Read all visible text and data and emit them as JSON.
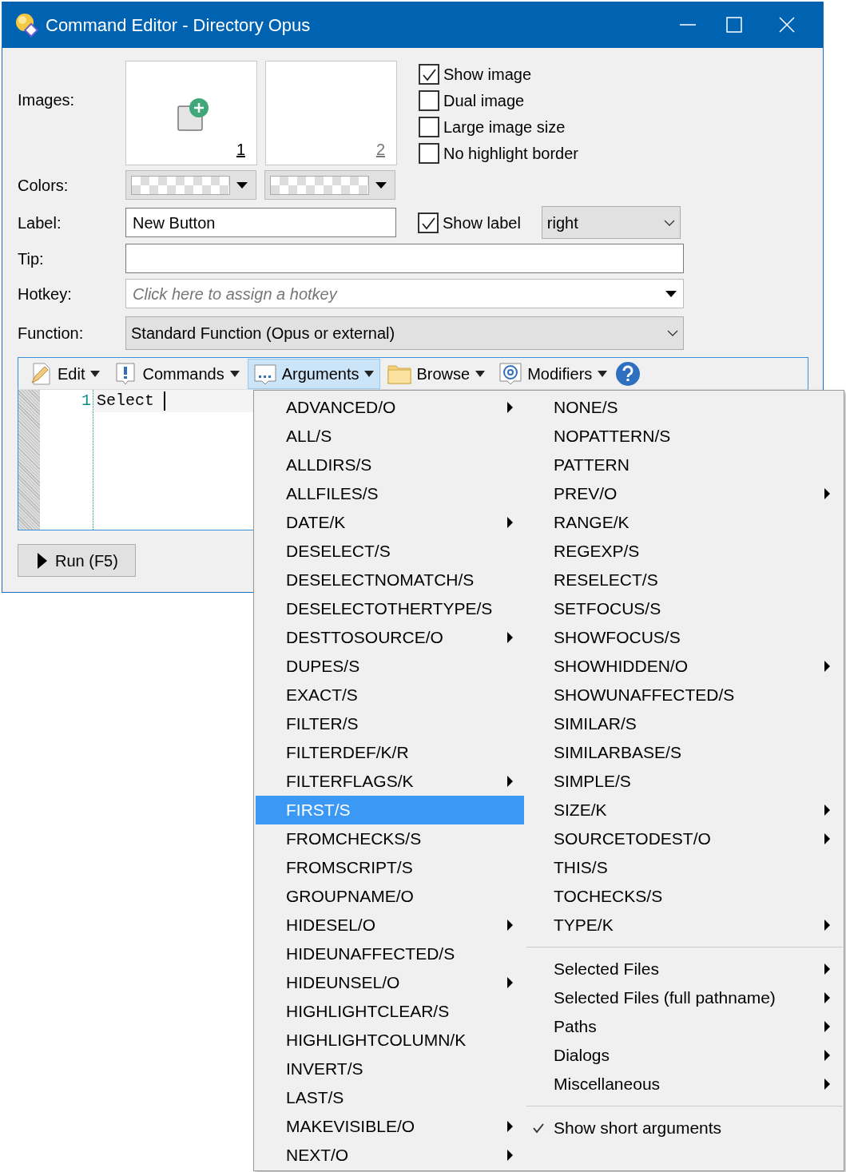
{
  "window": {
    "title": "Command Editor - Directory Opus"
  },
  "form": {
    "images_label": "Images:",
    "images": [
      {
        "number": "1",
        "disabled": false
      },
      {
        "number": "2",
        "disabled": true
      }
    ],
    "image_options": [
      {
        "label": "Show image",
        "checked": true
      },
      {
        "label": "Dual image",
        "checked": false
      },
      {
        "label": "Large image size",
        "checked": false
      },
      {
        "label": "No highlight border",
        "checked": false
      }
    ],
    "colors_label": "Colors:",
    "label_label": "Label:",
    "label_value": "New Button",
    "show_label": {
      "label": "Show label",
      "checked": true
    },
    "label_position": "right",
    "tip_label": "Tip:",
    "hotkey_label": "Hotkey:",
    "hotkey_placeholder": "Click here to assign a hotkey",
    "function_label": "Function:",
    "function_value": "Standard Function (Opus or external)"
  },
  "toolbar": [
    {
      "label": "Edit",
      "selected": false
    },
    {
      "label": "Commands",
      "selected": false
    },
    {
      "label": "Arguments",
      "selected": true
    },
    {
      "label": "Browse",
      "selected": false
    },
    {
      "label": "Modifiers",
      "selected": false
    }
  ],
  "editor": {
    "lines": [
      {
        "number": "1",
        "text": "Select "
      }
    ]
  },
  "run_button": "Run (F5)",
  "menu": {
    "left_items": [
      {
        "label": "ADVANCED/O",
        "submenu": true,
        "selected": false
      },
      {
        "label": "ALL/S",
        "submenu": false,
        "selected": false
      },
      {
        "label": "ALLDIRS/S",
        "submenu": false,
        "selected": false
      },
      {
        "label": "ALLFILES/S",
        "submenu": false,
        "selected": false
      },
      {
        "label": "DATE/K",
        "submenu": true,
        "selected": false
      },
      {
        "label": "DESELECT/S",
        "submenu": false,
        "selected": false
      },
      {
        "label": "DESELECTNOMATCH/S",
        "submenu": false,
        "selected": false
      },
      {
        "label": "DESELECTOTHERTYPE/S",
        "submenu": false,
        "selected": false
      },
      {
        "label": "DESTTOSOURCE/O",
        "submenu": true,
        "selected": false
      },
      {
        "label": "DUPES/S",
        "submenu": false,
        "selected": false
      },
      {
        "label": "EXACT/S",
        "submenu": false,
        "selected": false
      },
      {
        "label": "FILTER/S",
        "submenu": false,
        "selected": false
      },
      {
        "label": "FILTERDEF/K/R",
        "submenu": false,
        "selected": false
      },
      {
        "label": "FILTERFLAGS/K",
        "submenu": true,
        "selected": false
      },
      {
        "label": "FIRST/S",
        "submenu": false,
        "selected": true
      },
      {
        "label": "FROMCHECKS/S",
        "submenu": false,
        "selected": false
      },
      {
        "label": "FROMSCRIPT/S",
        "submenu": false,
        "selected": false
      },
      {
        "label": "GROUPNAME/O",
        "submenu": false,
        "selected": false
      },
      {
        "label": "HIDESEL/O",
        "submenu": true,
        "selected": false
      },
      {
        "label": "HIDEUNAFFECTED/S",
        "submenu": false,
        "selected": false
      },
      {
        "label": "HIDEUNSEL/O",
        "submenu": true,
        "selected": false
      },
      {
        "label": "HIGHLIGHTCLEAR/S",
        "submenu": false,
        "selected": false
      },
      {
        "label": "HIGHLIGHTCOLUMN/K",
        "submenu": false,
        "selected": false
      },
      {
        "label": "INVERT/S",
        "submenu": false,
        "selected": false
      },
      {
        "label": "LAST/S",
        "submenu": false,
        "selected": false
      },
      {
        "label": "MAKEVISIBLE/O",
        "submenu": true,
        "selected": false
      },
      {
        "label": "NEXT/O",
        "submenu": true,
        "selected": false
      }
    ],
    "right_sections": [
      [
        {
          "label": "NONE/S",
          "submenu": false,
          "selected": false
        },
        {
          "label": "NOPATTERN/S",
          "submenu": false,
          "selected": false
        },
        {
          "label": "PATTERN",
          "submenu": false,
          "selected": false
        },
        {
          "label": "PREV/O",
          "submenu": true,
          "selected": false
        },
        {
          "label": "RANGE/K",
          "submenu": false,
          "selected": false
        },
        {
          "label": "REGEXP/S",
          "submenu": false,
          "selected": false
        },
        {
          "label": "RESELECT/S",
          "submenu": false,
          "selected": false
        },
        {
          "label": "SETFOCUS/S",
          "submenu": false,
          "selected": false
        },
        {
          "label": "SHOWFOCUS/S",
          "submenu": false,
          "selected": false
        },
        {
          "label": "SHOWHIDDEN/O",
          "submenu": true,
          "selected": false
        },
        {
          "label": "SHOWUNAFFECTED/S",
          "submenu": false,
          "selected": false
        },
        {
          "label": "SIMILAR/S",
          "submenu": false,
          "selected": false
        },
        {
          "label": "SIMILARBASE/S",
          "submenu": false,
          "selected": false
        },
        {
          "label": "SIMPLE/S",
          "submenu": false,
          "selected": false
        },
        {
          "label": "SIZE/K",
          "submenu": true,
          "selected": false
        },
        {
          "label": "SOURCETODEST/O",
          "submenu": true,
          "selected": false
        },
        {
          "label": "THIS/S",
          "submenu": false,
          "selected": false
        },
        {
          "label": "TOCHECKS/S",
          "submenu": false,
          "selected": false
        },
        {
          "label": "TYPE/K",
          "submenu": true,
          "selected": false
        }
      ],
      [
        {
          "label": "Selected Files",
          "submenu": true,
          "selected": false
        },
        {
          "label": "Selected Files (full pathname)",
          "submenu": true,
          "selected": false
        },
        {
          "label": "Paths",
          "submenu": true,
          "selected": false
        },
        {
          "label": "Dialogs",
          "submenu": true,
          "selected": false
        },
        {
          "label": "Miscellaneous",
          "submenu": true,
          "selected": false
        }
      ],
      [
        {
          "label": "Show short arguments",
          "submenu": false,
          "selected": false,
          "checked": true
        }
      ]
    ]
  }
}
